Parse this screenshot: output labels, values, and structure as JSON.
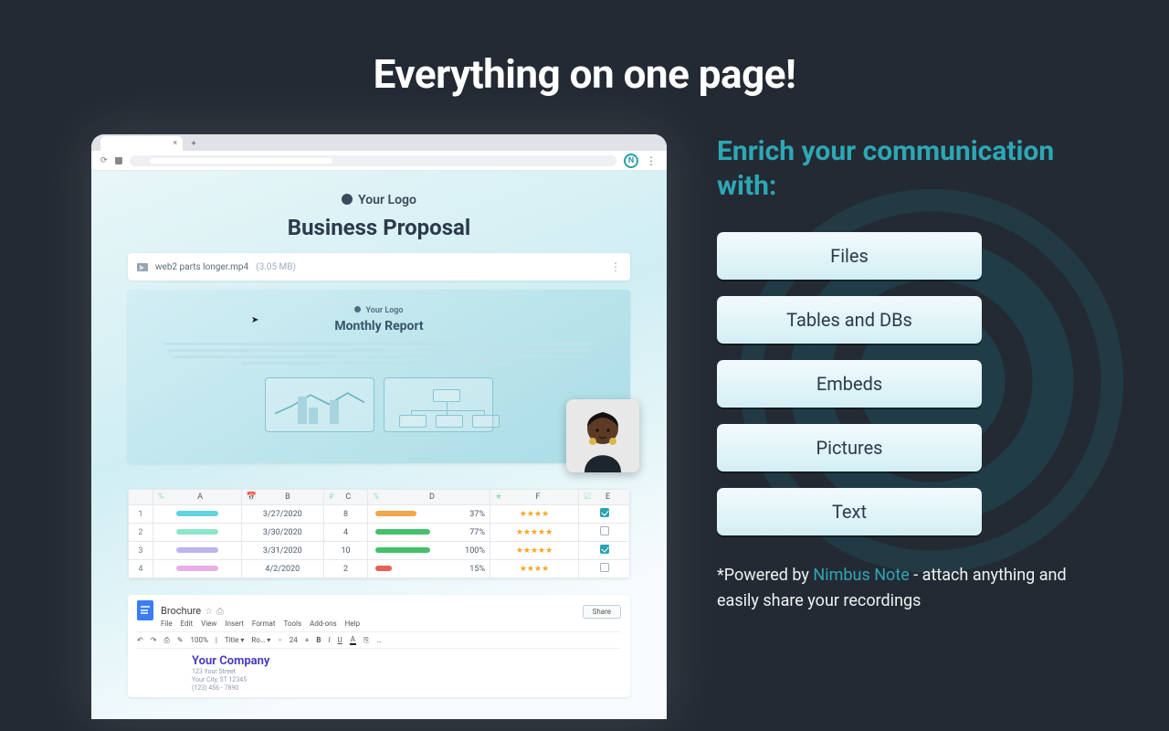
{
  "headline": "Everything on one page!",
  "right": {
    "subtitle": "Enrich your communication with:",
    "chips": [
      "Files",
      "Tables and DBs",
      "Embeds",
      "Pictures",
      "Text"
    ],
    "footer_prefix": "*Powered by ",
    "footer_link": "Nimbus Note",
    "footer_suffix": " - attach anything and easily share your recordings"
  },
  "browser": {
    "tab_close": "×",
    "tab_new": "+",
    "reload_glyph": "⟳",
    "ext_badge": "N",
    "menu_dots": "⋮"
  },
  "doc": {
    "logo_text": "Your Logo",
    "title": "Business Proposal",
    "file": {
      "name": "web2 parts longer.mp4",
      "size": "(3.05 MB)",
      "more": "⋮"
    },
    "report": {
      "logo_text": "Your Logo",
      "title": "Monthly Report"
    },
    "table": {
      "headers": {
        "idx": "",
        "A": "A",
        "B": "B",
        "Bhash": "#",
        "C": "C",
        "Cpct": "%",
        "D": "D",
        "F": "F",
        "E": "E"
      },
      "rows": [
        {
          "idx": "1",
          "pillA": "#5fd3df",
          "B": "3/27/2020",
          "C": "8",
          "pillD": "#f0a84a",
          "pct": "37%",
          "stars": "★★★★",
          "checked": true
        },
        {
          "idx": "2",
          "pillA": "#8be6c9",
          "B": "3/30/2020",
          "C": "4",
          "pillD": "#44c06a",
          "pct": "77%",
          "stars": "★★★★★",
          "checked": false
        },
        {
          "idx": "3",
          "pillA": "#bdb2ee",
          "B": "3/31/2020",
          "C": "10",
          "pillD": "#44c06a",
          "pct": "100%",
          "stars": "★★★★★",
          "checked": true
        },
        {
          "idx": "4",
          "pillA": "#e9aee5",
          "B": "4/2/2020",
          "C": "2",
          "pillD": "#e56055",
          "pct": "15%",
          "stars": "★★★★",
          "checked": false
        }
      ]
    },
    "gdocs": {
      "title": "Brochure",
      "star": "☆",
      "cloud": "⎙",
      "menus": [
        "File",
        "Edit",
        "View",
        "Insert",
        "Format",
        "Tools",
        "Add-ons",
        "Help"
      ],
      "share": "Share",
      "toolbar": {
        "undo": "↶",
        "redo": "↷",
        "print": "⎙",
        "paint": "✎",
        "zoom": "100%",
        "style": "Title ▾",
        "font": "Ro… ▾",
        "size_minus": "−",
        "size": "24",
        "size_plus": "+",
        "bold": "B",
        "italic": "I",
        "underline": "U",
        "color": "A",
        "link": "⎘",
        "more": "…"
      },
      "company": "Your Company",
      "addr": [
        "123 Your Street",
        "Your City, ST 12345",
        "(123) 456 - 7890"
      ]
    }
  }
}
